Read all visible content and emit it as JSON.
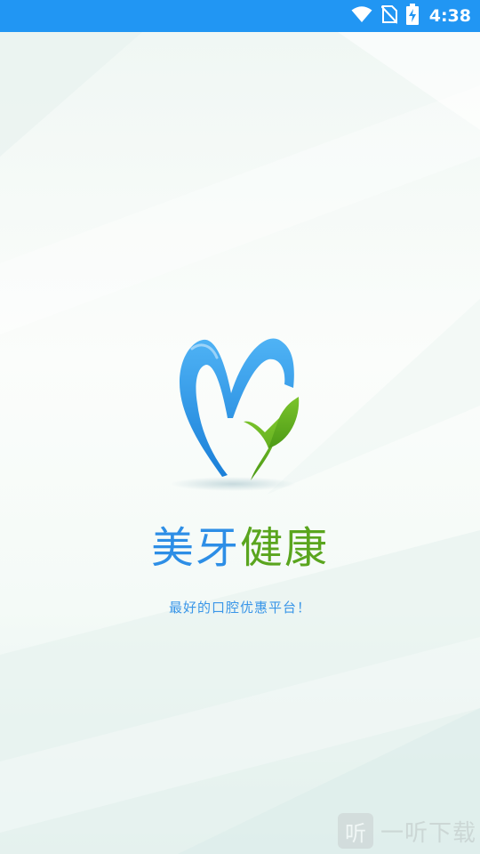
{
  "status_bar": {
    "time": "4:38",
    "icons": [
      "wifi-icon",
      "no-sim-icon",
      "battery-charging-icon"
    ],
    "background": "#2196f3"
  },
  "splash": {
    "brand_name_blue": "美牙",
    "brand_name_green": "健康",
    "tagline": "最好的口腔优惠平台！",
    "logo": "meiya-heart-logo",
    "brand_colors": {
      "blue": "#2d8ee6",
      "green": "#5aa51e"
    }
  },
  "watermark": {
    "badge": "听",
    "text": "一听下载"
  }
}
